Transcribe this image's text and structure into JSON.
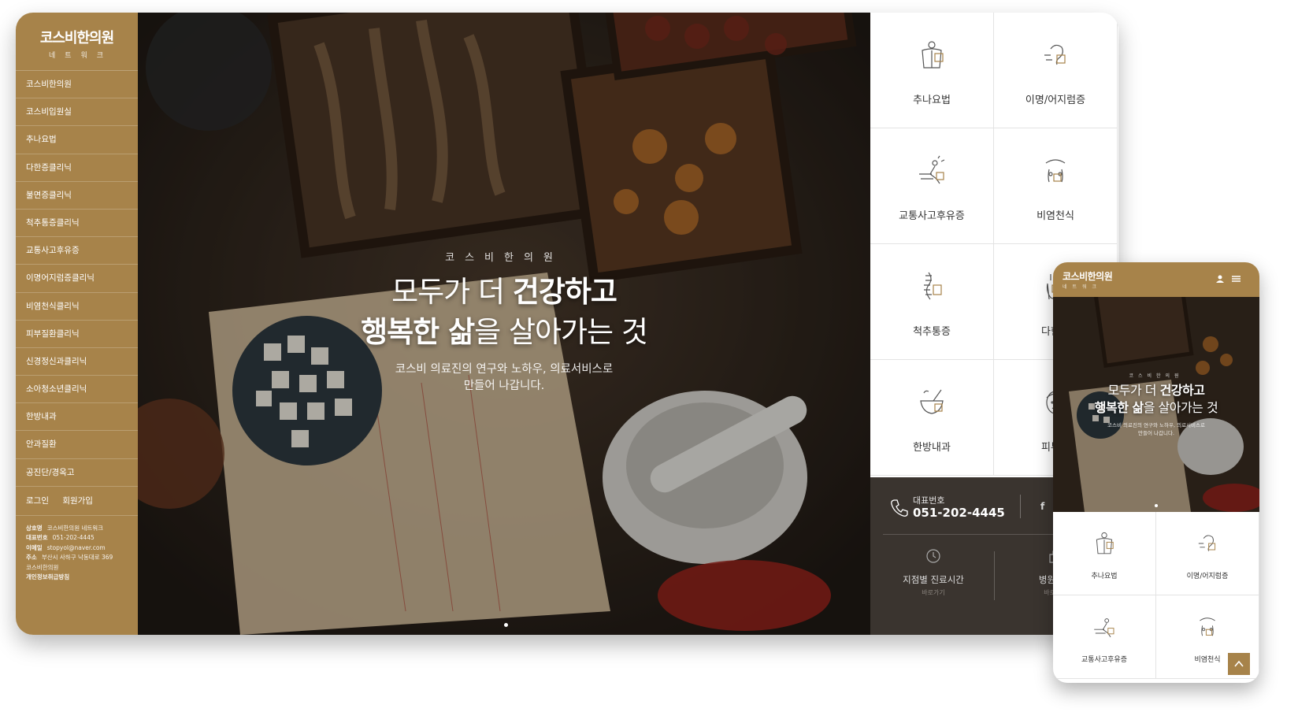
{
  "brand": {
    "name": "코스비한의원",
    "sub": "네트워크"
  },
  "sidebar": {
    "items": [
      "코스비한의원",
      "코스비입원실",
      "추나요법",
      "다한증클리닉",
      "불면증클리닉",
      "척추통증클리닉",
      "교통사고후유증",
      "이명어지럼증클리닉",
      "비염천식클리닉",
      "피부질환클리닉",
      "신경정신과클리닉",
      "소아청소년클리닉",
      "한방내과",
      "안과질환",
      "공진단/경옥고"
    ],
    "login": "로그인",
    "join": "회원가입",
    "info": {
      "company_label": "상호명",
      "company": "코스비한의원 네트워크",
      "tel_label": "대표번호",
      "tel": "051-202-4445",
      "email_label": "이메일",
      "email": "stopyol@naver.com",
      "addr_label": "주소",
      "addr": "부산시 사하구 낙동대로 369",
      "addr2": "코스비한의원",
      "privacy": "개인정보취급방침"
    }
  },
  "hero": {
    "small": "코스비한의원",
    "line1_normal": "모두가 더 ",
    "line1_bold": "건강하고",
    "line2_bold": "행복한 삶",
    "line2_normal": "을 살아가는 것",
    "desc1": "코스비 의료진의 연구와 노하우, 의료서비스로",
    "desc2": "만들어 나갑니다."
  },
  "clinics": [
    {
      "label": "추나요법",
      "icon": "body-icon"
    },
    {
      "label": "이명/어지럼증",
      "icon": "ear-icon"
    },
    {
      "label": "교통사고후유증",
      "icon": "accident-icon"
    },
    {
      "label": "비염천식",
      "icon": "lungs-icon"
    },
    {
      "label": "척추통증",
      "icon": "spine-icon"
    },
    {
      "label": "다한증",
      "icon": "hand-icon"
    },
    {
      "label": "한방내과",
      "icon": "mortar-icon"
    },
    {
      "label": "피부질",
      "icon": "face-icon"
    }
  ],
  "contact": {
    "label": "대표번호",
    "number": "051-202-4445",
    "sns": [
      "f",
      "●",
      "◎"
    ],
    "quick": [
      {
        "title": "지점별 진료시간",
        "sub": "바로가기"
      },
      {
        "title": "병원소개",
        "sub": "바로가기"
      }
    ]
  },
  "mobile": {
    "brand": "코스비한의원",
    "brand_sub": "네트워크",
    "hero_small": "코스비한의원",
    "hero_desc1": "코스비 의료진의 연구와 노하우, 의료서비스로",
    "hero_desc2": "만들어 나갑니다.",
    "clinics": [
      "추나요법",
      "이명/어지럼증",
      "교통사고후유증",
      "비염천식"
    ]
  },
  "colors": {
    "accent": "#a7834a",
    "dark": "#3a342f"
  }
}
